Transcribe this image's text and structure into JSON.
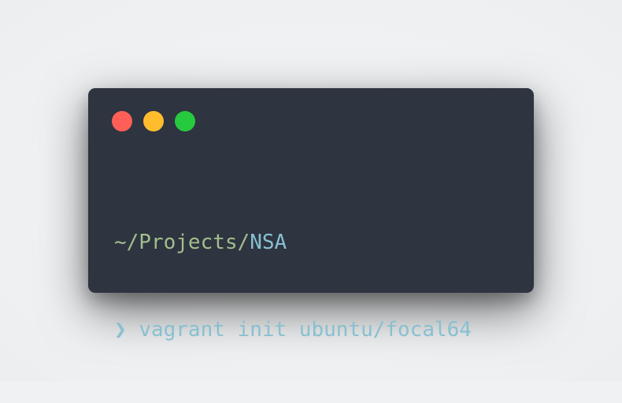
{
  "window": {
    "controls": {
      "close_color": "#ff5f56",
      "minimize_color": "#ffbd2e",
      "zoom_color": "#27c93f"
    }
  },
  "terminal": {
    "cwd_prefix": "~/Projects/",
    "cwd_dir": "NSA",
    "prompt_symbol": "❯",
    "command": "vagrant init ubuntu/focal64"
  },
  "colors": {
    "background": "#2e3440",
    "path_prefix": "#a3be8c",
    "path_dir": "#88c0d0",
    "command": "#88c0d0"
  }
}
